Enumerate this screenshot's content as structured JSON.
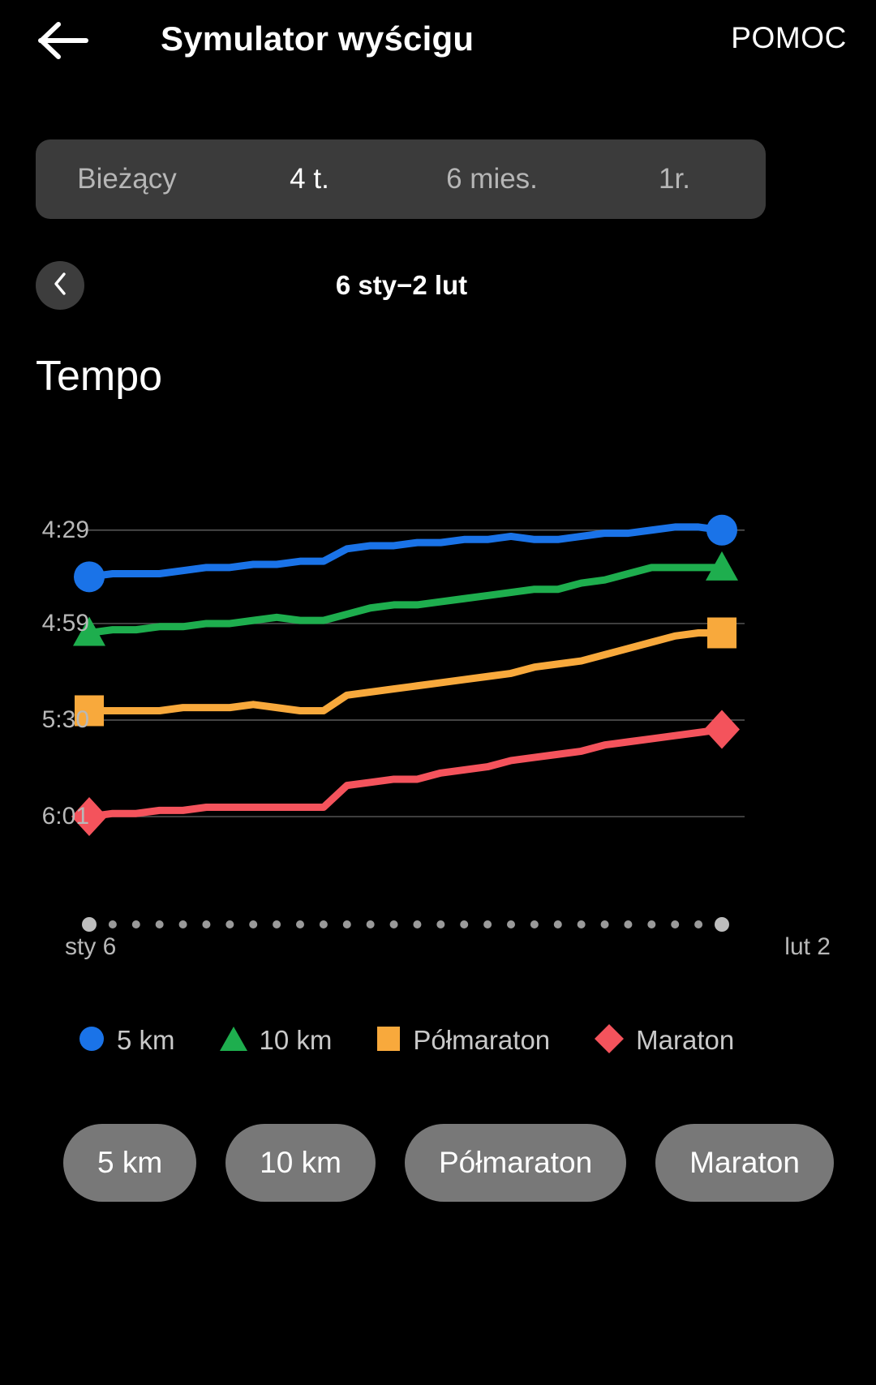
{
  "appbar": {
    "back_icon": "arrow-left-icon",
    "title": "Symulator wyścigu",
    "help_label": "POMOC"
  },
  "range_tabs": {
    "selected": "4 t.",
    "items": [
      {
        "label": "Bieżący",
        "selected": false
      },
      {
        "label": "4 t.",
        "selected": true
      },
      {
        "label": "6 mies.",
        "selected": false
      },
      {
        "label": "1r.",
        "selected": false
      }
    ]
  },
  "date_nav": {
    "prev_icon": "chevron-left-icon",
    "range_label": "6 sty−2 lut"
  },
  "section": {
    "title": "Tempo"
  },
  "legend": {
    "items": [
      {
        "label": "5 km",
        "marker": "circle-marker",
        "color": "#1a73e8"
      },
      {
        "label": "10 km",
        "marker": "triangle-marker",
        "color": "#1eae4e"
      },
      {
        "label": "Półmaraton",
        "marker": "square-marker",
        "color": "#f8a93c"
      },
      {
        "label": "Maraton",
        "marker": "diamond-marker",
        "color": "#f4535c"
      }
    ]
  },
  "chips": {
    "items": [
      "5 km",
      "10 km",
      "Półmaraton",
      "Maraton"
    ]
  },
  "chart_data": {
    "type": "line",
    "title": "Tempo",
    "xlabel": "",
    "ylabel": "",
    "grid": true,
    "legend_position": "bottom",
    "y_tick_labels": [
      "4:29",
      "4:59",
      "5:30",
      "6:01"
    ],
    "y_tick_values": [
      269,
      299,
      330,
      361
    ],
    "ylim": [
      380,
      255
    ],
    "y_axis_note": "Tempo in min:sec per km; smaller (faster) pace is higher on the chart",
    "x_tick_labels": [
      "sty 6",
      "lut 2"
    ],
    "x_start": "sty 6",
    "x_end": "lut 2",
    "x_point_count": 28,
    "series": [
      {
        "name": "5 km",
        "color": "#1a73e8",
        "marker": "circle",
        "values": [
          284,
          283,
          283,
          283,
          282,
          281,
          281,
          280,
          280,
          279,
          279,
          275,
          274,
          274,
          273,
          273,
          272,
          272,
          271,
          272,
          272,
          271,
          270,
          270,
          269,
          268,
          268,
          269
        ]
      },
      {
        "name": "10 km",
        "color": "#1eae4e",
        "marker": "triangle",
        "values": [
          302,
          301,
          301,
          300,
          300,
          299,
          299,
          298,
          297,
          298,
          298,
          296,
          294,
          293,
          293,
          292,
          291,
          290,
          289,
          288,
          288,
          286,
          285,
          283,
          281,
          281,
          281,
          281
        ]
      },
      {
        "name": "Półmaraton",
        "color": "#f8a93c",
        "marker": "square",
        "values": [
          327,
          327,
          327,
          327,
          326,
          326,
          326,
          325,
          326,
          327,
          327,
          322,
          321,
          320,
          319,
          318,
          317,
          316,
          315,
          313,
          312,
          311,
          309,
          307,
          305,
          303,
          302,
          302
        ]
      },
      {
        "name": "Maraton",
        "color": "#f4535c",
        "marker": "diamond",
        "values": [
          361,
          360,
          360,
          359,
          359,
          358,
          358,
          358,
          358,
          358,
          358,
          351,
          350,
          349,
          349,
          347,
          346,
          345,
          343,
          342,
          341,
          340,
          338,
          337,
          336,
          335,
          334,
          333
        ]
      }
    ]
  }
}
